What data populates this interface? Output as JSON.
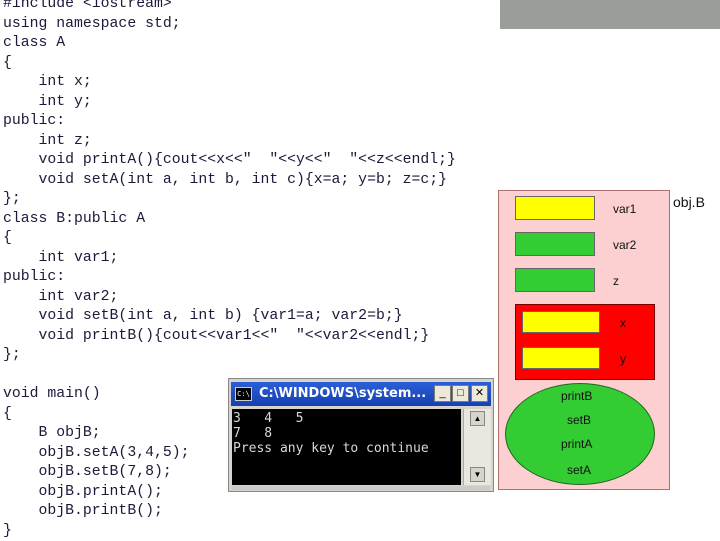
{
  "code": {
    "lines": [
      "#include <iostream>",
      "using namespace std;",
      "class A",
      "{",
      "    int x;",
      "    int y;",
      "public:",
      "    int z;",
      "    void printA(){cout<<x<<\"  \"<<y<<\"  \"<<z<<endl;}",
      "    void setA(int a, int b, int c){x=a; y=b; z=c;}",
      "};",
      "class B:public A",
      "{",
      "    int var1;",
      "public:",
      "    int var2;",
      "    void setB(int a, int b) {var1=a; var2=b;}",
      "    void printB(){cout<<var1<<\"  \"<<var2<<endl;}",
      "};",
      "",
      "void main()",
      "{",
      "    B objB;",
      "    objB.setA(3,4,5);",
      "    objB.setB(7,8);",
      "    objB.printA();",
      "    objB.printB();",
      "}"
    ]
  },
  "diagram": {
    "object_label": "obj.B",
    "members": {
      "var1": "var1",
      "var2": "var2",
      "z": "z",
      "x": "x",
      "y": "y"
    },
    "methods": [
      "printB",
      "setB",
      "printA",
      "setA"
    ],
    "colors": {
      "panel": "#fcd0d0",
      "public_member": "#33cc33",
      "private_member": "#ffff00",
      "inherited_private": "#ff0000"
    }
  },
  "console": {
    "title": "C:\\WINDOWS\\system...",
    "icon_text": "C:\\",
    "buttons": {
      "minimize": "_",
      "maximize": "□",
      "close": "✕"
    },
    "output": [
      "3   4   5",
      "7   8",
      "Press any key to continue"
    ]
  }
}
